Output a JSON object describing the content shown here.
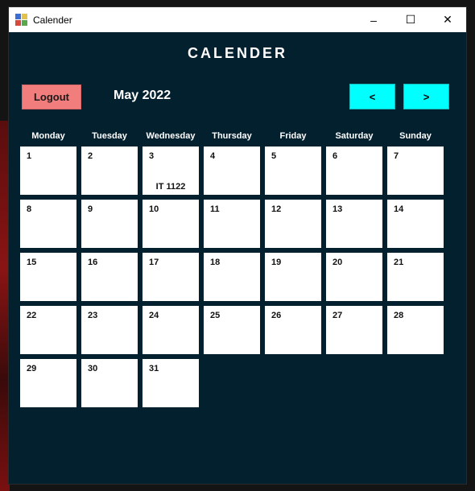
{
  "window": {
    "title": "Calender",
    "controls": {
      "minimize": "–",
      "maximize": "☐",
      "close": "✕"
    }
  },
  "heading": "CALENDER",
  "toolbar": {
    "logout_label": "Logout",
    "month_label": "May 2022",
    "prev_label": "<",
    "next_label": ">"
  },
  "weekdays": [
    "Monday",
    "Tuesday",
    "Wednesday",
    "Thursday",
    "Friday",
    "Saturday",
    "Sunday"
  ],
  "calendar": {
    "days": [
      {
        "day": "1",
        "event": ""
      },
      {
        "day": "2",
        "event": ""
      },
      {
        "day": "3",
        "event": "IT 1122"
      },
      {
        "day": "4",
        "event": ""
      },
      {
        "day": "5",
        "event": ""
      },
      {
        "day": "6",
        "event": ""
      },
      {
        "day": "7",
        "event": ""
      },
      {
        "day": "8",
        "event": ""
      },
      {
        "day": "9",
        "event": ""
      },
      {
        "day": "10",
        "event": ""
      },
      {
        "day": "11",
        "event": ""
      },
      {
        "day": "12",
        "event": ""
      },
      {
        "day": "13",
        "event": ""
      },
      {
        "day": "14",
        "event": ""
      },
      {
        "day": "15",
        "event": ""
      },
      {
        "day": "16",
        "event": ""
      },
      {
        "day": "17",
        "event": ""
      },
      {
        "day": "18",
        "event": ""
      },
      {
        "day": "19",
        "event": ""
      },
      {
        "day": "20",
        "event": ""
      },
      {
        "day": "21",
        "event": ""
      },
      {
        "day": "22",
        "event": ""
      },
      {
        "day": "23",
        "event": ""
      },
      {
        "day": "24",
        "event": ""
      },
      {
        "day": "25",
        "event": ""
      },
      {
        "day": "26",
        "event": ""
      },
      {
        "day": "27",
        "event": ""
      },
      {
        "day": "28",
        "event": ""
      },
      {
        "day": "29",
        "event": ""
      },
      {
        "day": "30",
        "event": ""
      },
      {
        "day": "31",
        "event": ""
      }
    ]
  },
  "colors": {
    "window_bg": "#03202f",
    "logout_bg": "#f27d7d",
    "nav_bg": "#00ffff",
    "cell_bg": "#ffffff"
  },
  "icons": {
    "app": "calendar-app-icon",
    "minimize": "minimize-icon",
    "maximize": "maximize-icon",
    "close": "close-icon"
  }
}
